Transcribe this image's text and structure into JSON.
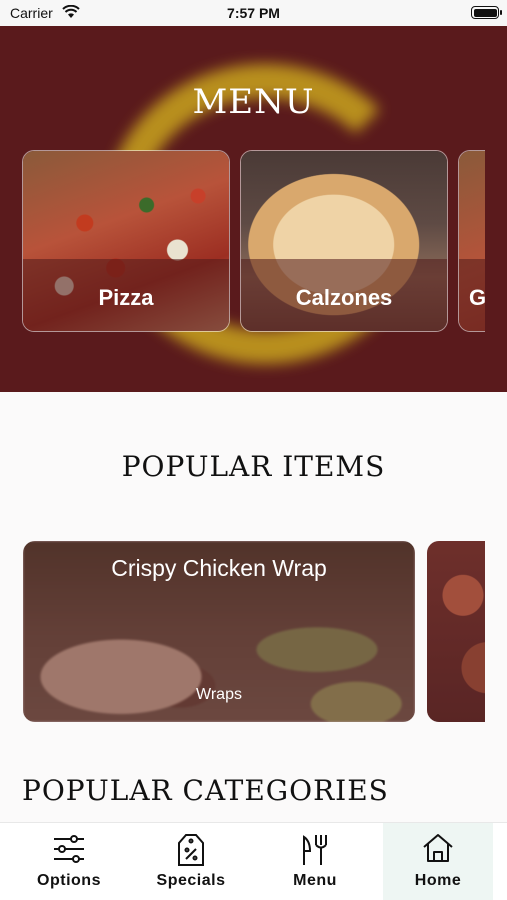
{
  "status_bar": {
    "carrier": "Carrier",
    "time": "7:57 PM"
  },
  "hero": {
    "title": "MENU",
    "categories": [
      {
        "label": "Pizza"
      },
      {
        "label": "Calzones"
      },
      {
        "label": "G"
      }
    ]
  },
  "popular_items": {
    "title": "POPULAR ITEMS",
    "items": [
      {
        "name": "Crispy Chicken Wrap",
        "category": "Wraps"
      }
    ]
  },
  "popular_categories": {
    "title": "POPULAR CATEGORIES"
  },
  "tab_bar": {
    "tabs": [
      {
        "label": "Options",
        "icon": "sliders-icon"
      },
      {
        "label": "Specials",
        "icon": "price-tag-icon"
      },
      {
        "label": "Menu",
        "icon": "fork-knife-icon"
      },
      {
        "label": "Home",
        "icon": "home-icon",
        "selected": true
      }
    ]
  },
  "colors": {
    "hero_bg": "#5a1a1c",
    "logo_gold": "#c9a41e",
    "home_tab_bg": "#eef6f3"
  }
}
